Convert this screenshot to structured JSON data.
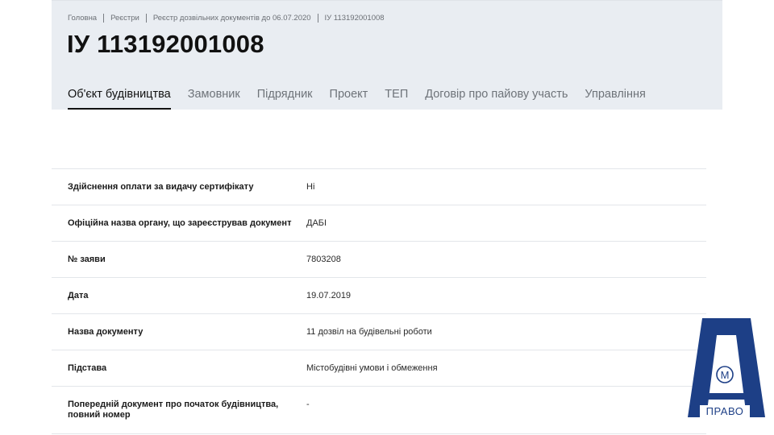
{
  "breadcrumb": [
    {
      "label": "Головна"
    },
    {
      "label": "Реєстри"
    },
    {
      "label": "Реєстр дозвільних документів до 06.07.2020"
    },
    {
      "label": "ІУ 113192001008"
    }
  ],
  "page_title": "ІУ 113192001008",
  "tabs": [
    {
      "label": "Об'єкт будівництва",
      "active": true
    },
    {
      "label": "Замовник"
    },
    {
      "label": "Підрядник"
    },
    {
      "label": "Проект"
    },
    {
      "label": "ТЕП"
    },
    {
      "label": "Договір про пайову участь"
    },
    {
      "label": "Управління"
    }
  ],
  "rows": [
    {
      "label": "Здійснення оплати за видачу сертифікату",
      "value": "Ні"
    },
    {
      "label": "Офіційна назва органу, що зареєстрував документ",
      "value": "ДАБІ"
    },
    {
      "label": "№ заяви",
      "value": "7803208"
    },
    {
      "label": "Дата",
      "value": "19.07.2019"
    },
    {
      "label": "Назва документу",
      "value": "11 дозвіл на будівельні роботи"
    },
    {
      "label": "Підстава",
      "value": "Містобудівні умови і обмеження"
    },
    {
      "label": "Попередній документ про початок будівництва, повний номер",
      "value": "-"
    }
  ],
  "logo": {
    "monogram": "М",
    "text": "ПРАВО"
  },
  "colors": {
    "header_bg": "#e9edf2",
    "logo_blue": "#1d3f86",
    "border": "#e3e6ea"
  }
}
